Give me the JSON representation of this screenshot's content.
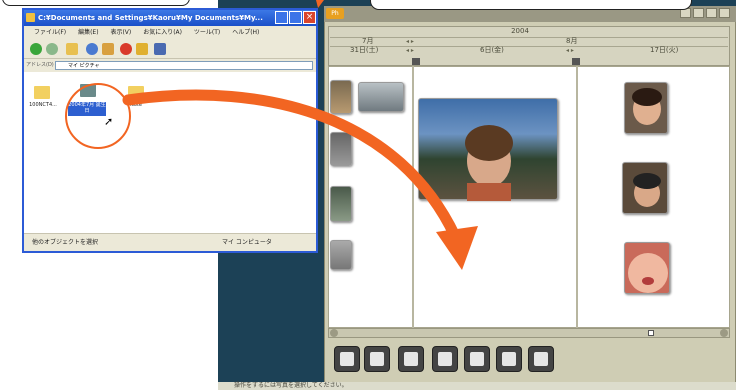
{
  "explorer": {
    "title": "C:¥Documents and Settings¥Kaoru¥My Documents¥My...",
    "menu": [
      "ファイル(F)",
      "編集(E)",
      "表示(V)",
      "お気に入り(A)",
      "ツール(T)",
      "ヘルプ(H)"
    ],
    "address_label": "アドレス(D)",
    "address_value": "マイ ピクチャ",
    "folders": [
      {
        "label": "100NCT4..."
      },
      {
        "label": "2004年7月 誕生日"
      },
      {
        "label": "Note"
      }
    ],
    "status_left": "他のオブジェクトを選択",
    "status_right": "マイ コンピュータ"
  },
  "app": {
    "logo": "Ph",
    "year": "2004",
    "months": [
      "7月",
      "8月"
    ],
    "days": [
      "31日(土)",
      "6日(金)",
      "17日(火)"
    ],
    "status_text": "操作をするには写真を選択してください。"
  },
  "colors": {
    "arrow": "#f26522",
    "highlight_circle": "#f26522",
    "explorer_border": "#2c5bd6",
    "app_background": "#1c4156"
  },
  "icons": [
    "back-icon",
    "forward-icon",
    "up-folder-icon",
    "search-icon",
    "folders-icon",
    "delete-icon",
    "views-icon",
    "cursor-icon"
  ]
}
